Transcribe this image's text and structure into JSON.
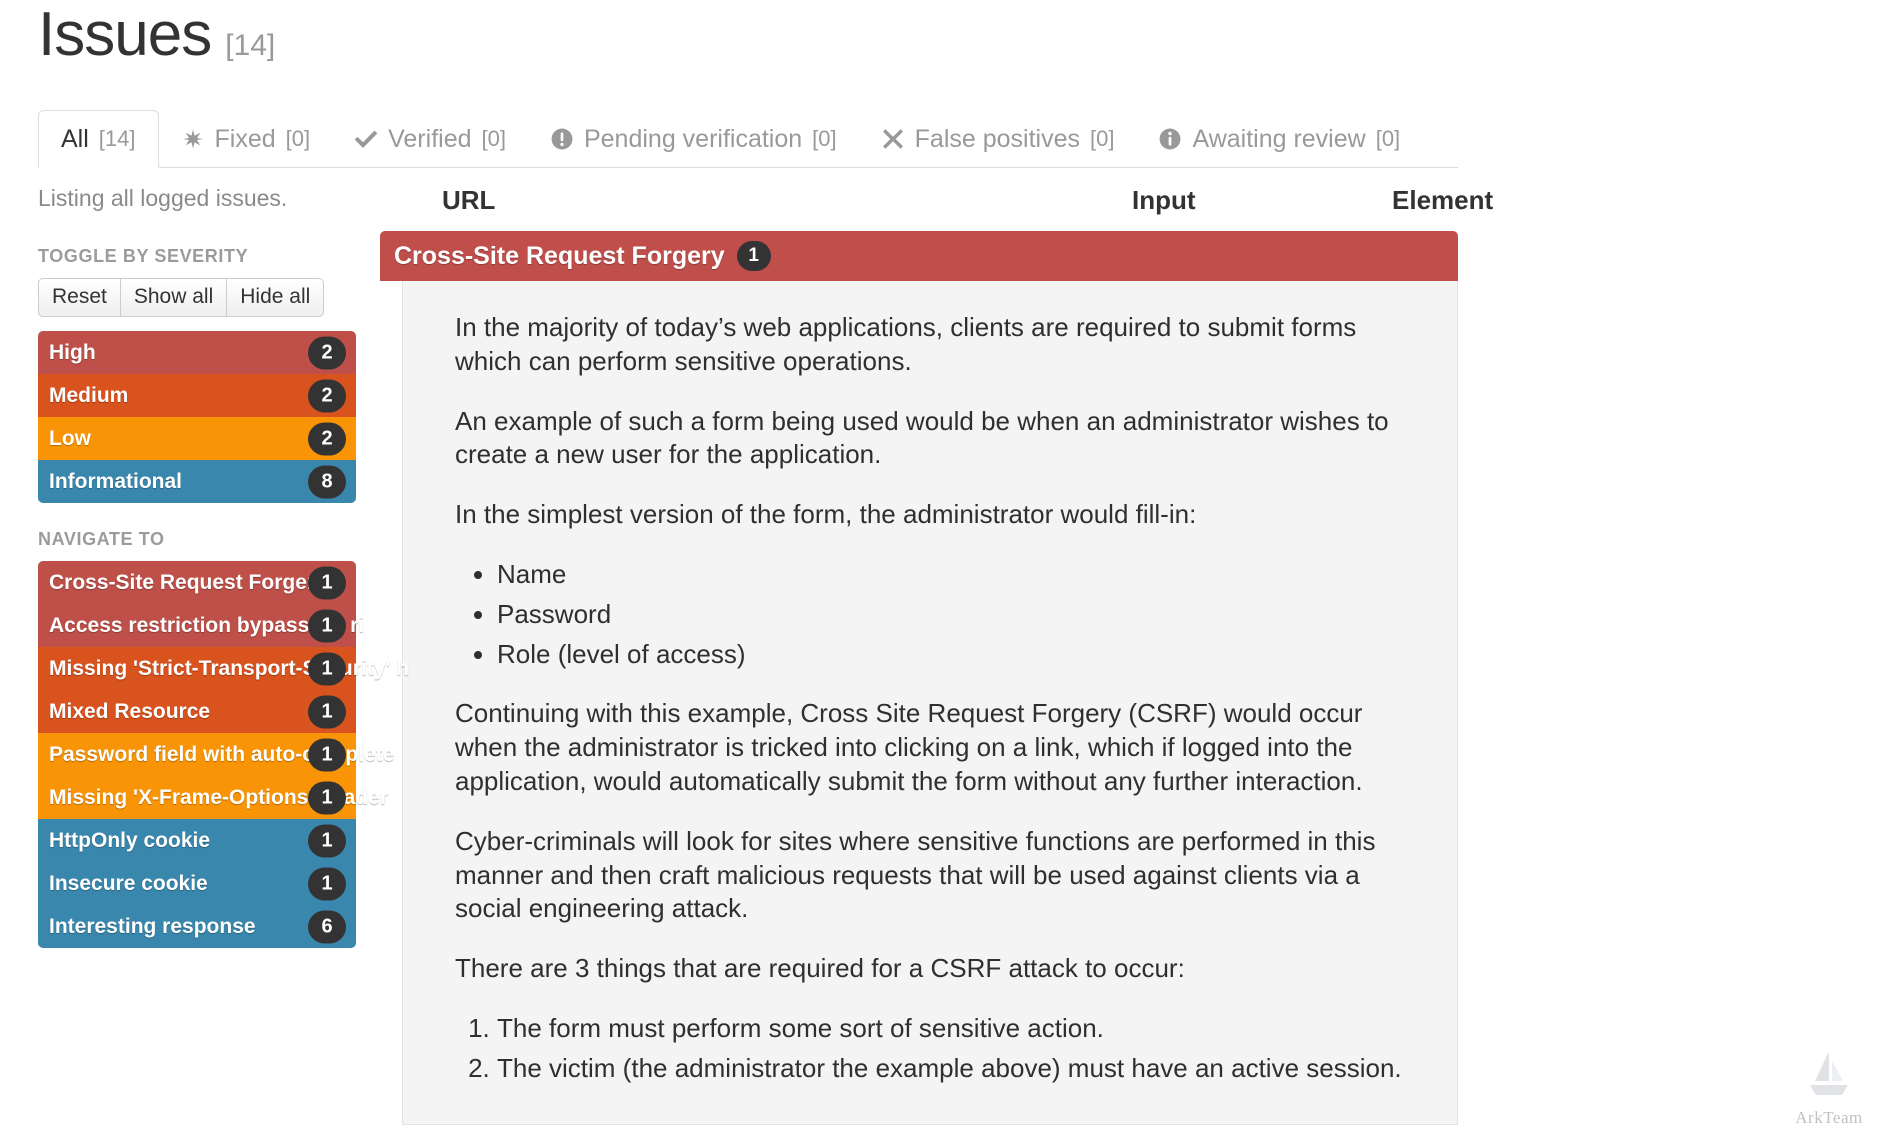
{
  "header": {
    "title": "Issues",
    "count": "[14]"
  },
  "tabs": [
    {
      "label": "All",
      "count": "[14]",
      "icon": "none",
      "active": true
    },
    {
      "label": "Fixed",
      "count": "[0]",
      "icon": "asterisk-icon",
      "active": false
    },
    {
      "label": "Verified",
      "count": "[0]",
      "icon": "check-icon",
      "active": false
    },
    {
      "label": "Pending verification",
      "count": "[0]",
      "icon": "exclamation-circle-icon",
      "active": false
    },
    {
      "label": "False positives",
      "count": "[0]",
      "icon": "times-icon",
      "active": false
    },
    {
      "label": "Awaiting review",
      "count": "[0]",
      "icon": "info-circle-icon",
      "active": false
    }
  ],
  "sidebar": {
    "listing_note": "Listing all logged issues.",
    "severity_section_title": "TOGGLE BY SEVERITY",
    "buttons": [
      {
        "label": "Reset"
      },
      {
        "label": "Show all"
      },
      {
        "label": "Hide all"
      }
    ],
    "severities": [
      {
        "label": "High",
        "count": "2",
        "color": "#be5049"
      },
      {
        "label": "Medium",
        "count": "2",
        "color": "#d9531e"
      },
      {
        "label": "Low",
        "count": "2",
        "color": "#f89406"
      },
      {
        "label": "Informational",
        "count": "8",
        "color": "#3a87ad"
      }
    ],
    "navigate_section_title": "NAVIGATE TO",
    "navigate_items": [
      {
        "label": "Cross-Site Request Forgery",
        "count": "1",
        "color": "#be5049"
      },
      {
        "label": "Access restriction bypass via ri",
        "count": "1",
        "color": "#be5049"
      },
      {
        "label": "Missing 'Strict-Transport-Security' h",
        "count": "1",
        "color": "#d9531e"
      },
      {
        "label": "Mixed Resource",
        "count": "1",
        "color": "#d9531e"
      },
      {
        "label": "Password field with auto-complete",
        "count": "1",
        "color": "#f89406"
      },
      {
        "label": "Missing 'X-Frame-Options' header",
        "count": "1",
        "color": "#f89406"
      },
      {
        "label": "HttpOnly cookie",
        "count": "1",
        "color": "#3a87ad"
      },
      {
        "label": "Insecure cookie",
        "count": "1",
        "color": "#3a87ad"
      },
      {
        "label": "Interesting response",
        "count": "6",
        "color": "#3a87ad"
      }
    ]
  },
  "main": {
    "columns": {
      "url": "URL",
      "input": "Input",
      "element": "Element"
    },
    "issue": {
      "title": "Cross-Site Request Forgery",
      "count": "1",
      "paragraphs": [
        "In the majority of today’s web applications, clients are required to submit forms which can perform sensitive operations.",
        "An example of such a form being used would be when an administrator wishes to create a new user for the application.",
        "In the simplest version of the form, the administrator would fill-in:"
      ],
      "bullets": [
        "Name",
        "Password",
        "Role (level of access)"
      ],
      "paragraphs_2": [
        "Continuing with this example, Cross Site Request Forgery (CSRF) would occur when the administrator is tricked into clicking on a link, which if logged into the application, would automatically submit the form without any further interaction.",
        "Cyber-criminals will look for sites where sensitive functions are performed in this manner and then craft malicious requests that will be used against clients via a social engineering attack.",
        "There are 3 things that are required for a CSRF attack to occur:"
      ],
      "numbered": [
        "The form must perform some sort of sensitive action.",
        "The victim (the administrator the example above) must have an active session."
      ]
    }
  },
  "watermark": {
    "label": "ArkTeam"
  }
}
